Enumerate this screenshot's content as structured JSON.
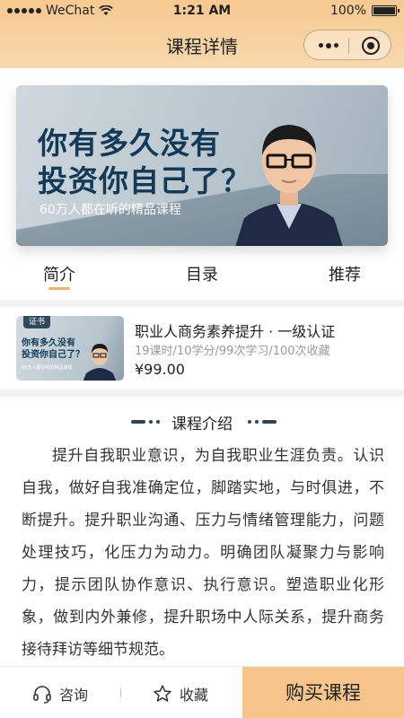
{
  "status_bar": {
    "carrier": "WeChat",
    "time": "1:21 AM",
    "battery": "100%"
  },
  "nav": {
    "title": "课程详情"
  },
  "banner": {
    "headline_line1": "你有多久没有",
    "headline_line2": "投资你自己了？",
    "subtitle": "60万人都在听的精品课程"
  },
  "tabs": [
    {
      "label": "简介",
      "active": true
    },
    {
      "label": "目录"
    },
    {
      "label": "推荐"
    }
  ],
  "course": {
    "thumb_tag": "证书",
    "thumb_line1": "你有多久没有",
    "thumb_line2": "投资你自己了？",
    "thumb_sub": "60万人都在听的精品课程",
    "title": "职业人商务素养提升 · 一级认证",
    "meta": "19课时/10学分/99次学习/100次收藏",
    "price": "¥99.00"
  },
  "intro": {
    "section_title": "课程介绍",
    "text": "提升自我职业意识，为自我职业生涯负责。认识自我，做好自我准确定位，脚踏实地，与时俱进，不断提升。提升职业沟通、压力与情绪管理能力，问题处理技巧，化压力为动力。明确团队凝聚力与影响力，提示团队协作意识、执行意识。塑造职业化形象，做到内外兼修，提升职场中人际关系，提升商务接待拜访等细节规范。"
  },
  "bottom_bar": {
    "consult_label": "咨询",
    "favorite_label": "收藏",
    "buy_label": "购买课程"
  },
  "colors": {
    "accent": "#f7c48b",
    "header_gradient_top": "#f6c98f",
    "tab_underline": "#f0b36a",
    "banner_text": "#123a57"
  }
}
